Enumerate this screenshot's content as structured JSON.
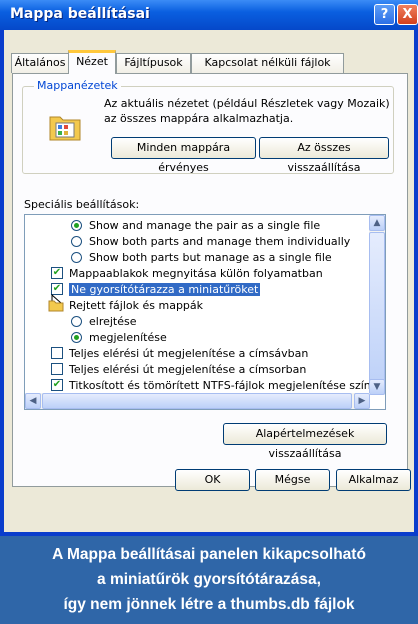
{
  "window": {
    "title": "Mappa beállításai",
    "help_label": "?",
    "close_label": "X"
  },
  "tabs": [
    {
      "label": "Általános"
    },
    {
      "label": "Nézet"
    },
    {
      "label": "Fájltípusok"
    },
    {
      "label": "Kapcsolat nélküli fájlok"
    }
  ],
  "folder_views": {
    "group_label": "Mappanézetek",
    "description_line1": "Az aktuális nézetet (például Részletek vagy Mozaik)",
    "description_line2": "az összes mappára alkalmazhatja.",
    "apply_all_label": "Minden mappára érvényes",
    "reset_all_label": "Az összes visszaállítása",
    "icon": "folder-view-icon"
  },
  "advanced": {
    "label": "Speciális beállítások:",
    "items": [
      {
        "type": "radio",
        "checked": true,
        "label": "Show and manage the pair as a single file"
      },
      {
        "type": "radio",
        "checked": false,
        "label": "Show both parts and manage them individually"
      },
      {
        "type": "radio",
        "checked": false,
        "label": "Show both parts but manage as a single file"
      },
      {
        "type": "check",
        "checked": true,
        "label": "Mappaablakok megnyitása külön folyamatban"
      },
      {
        "type": "check",
        "checked": true,
        "label": "Ne gyorsítótárazza a miniatűröket",
        "selected": true
      },
      {
        "type": "folder",
        "label": "Rejtett fájlok és mappák"
      },
      {
        "type": "radio",
        "checked": false,
        "label": "elrejtése"
      },
      {
        "type": "radio",
        "checked": true,
        "label": "megjelenítése"
      },
      {
        "type": "check",
        "checked": false,
        "label": "Teljes elérési út megjelenítése a címsávban"
      },
      {
        "type": "check",
        "checked": false,
        "label": "Teljes elérési út megjelenítése a címsorban"
      },
      {
        "type": "check",
        "checked": true,
        "label": "Titkosított és tömörített NTFS-fájlok megjelenítése színek"
      }
    ],
    "restore_defaults_label": "Alapértelmezések visszaállítása"
  },
  "footer": {
    "ok_label": "OK",
    "cancel_label": "Mégse",
    "apply_label": "Alkalmaz"
  },
  "caption": {
    "line1": "A Mappa beállításai panelen kikapcsolható",
    "line2": "a miniatűrök gyorsítótárazása,",
    "line3": "így nem jönnek létre a thumbs.db fájlok"
  },
  "colors": {
    "titlebar": "#0a5fe0",
    "dialog_bg": "#ece9d8",
    "caption_bg": "#2f66a8",
    "selection": "#316ac5"
  }
}
